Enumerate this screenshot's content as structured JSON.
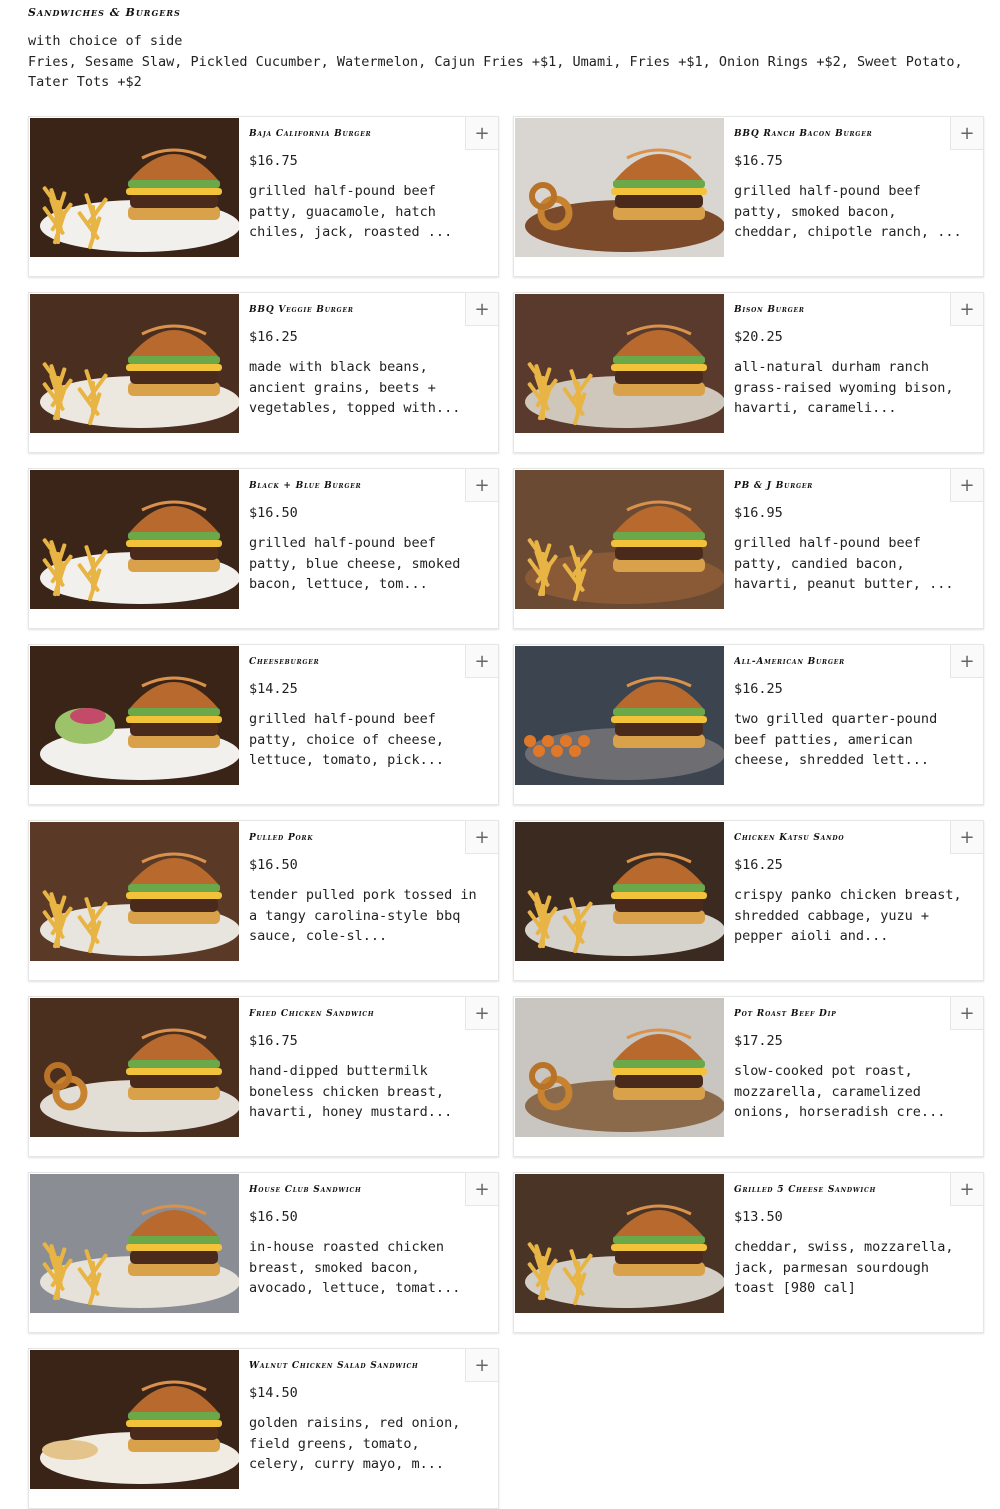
{
  "section": {
    "title": "Sandwiches & Burgers",
    "subtitle": "with choice of side",
    "sides": "Fries, Sesame Slaw, Pickled Cucumber, Watermelon, Cajun Fries +$1, Umami, Fries +$1, Onion Rings +$2, Sweet Potato, Tater Tots +$2"
  },
  "add_label": "+",
  "items": [
    {
      "name": "Baja California Burger",
      "price": "$16.75",
      "desc": "grilled half-pound beef patty, guacamole, hatch chiles, jack, roasted ...",
      "bg": "#3a2418",
      "plate": "#f2f0ec",
      "side": "fries"
    },
    {
      "name": "BBQ Ranch Bacon Burger",
      "price": "$16.75",
      "desc": "grilled half-pound beef patty, smoked bacon, cheddar, chipotle ranch, ...",
      "bg": "#d9d6d2",
      "plate": "#7a4a2a",
      "side": "rings"
    },
    {
      "name": "BBQ Veggie Burger",
      "price": "$16.25",
      "desc": "made with black beans, ancient grains, beets + vegetables, topped with...",
      "bg": "#4a2e20",
      "plate": "#ece7df",
      "side": "fries"
    },
    {
      "name": "Bison Burger",
      "price": "$20.25",
      "desc": "all-natural durham ranch grass-raised wyoming bison, havarti, carameli...",
      "bg": "#5a3a2c",
      "plate": "#cfc6bc",
      "side": "fries"
    },
    {
      "name": "Black + Blue Burger",
      "price": "$16.50",
      "desc": "grilled half-pound beef patty, blue cheese, smoked bacon, lettuce, tom...",
      "bg": "#3b2519",
      "plate": "#f2f0ec",
      "side": "fries"
    },
    {
      "name": "PB & J Burger",
      "price": "$16.95",
      "desc": "grilled half-pound beef patty, candied bacon, havarti, peanut butter, ...",
      "bg": "#6b4a33",
      "plate": "#8a5a36",
      "side": "fries"
    },
    {
      "name": "Cheeseburger",
      "price": "$14.25",
      "desc": "grilled half-pound beef patty, choice of cheese, lettuce, tomato, pick...",
      "bg": "#3a2418",
      "plate": "#f2f0ec",
      "side": "salad"
    },
    {
      "name": "All-American Burger",
      "price": "$16.25",
      "desc": "two grilled quarter-pound beef patties, american cheese, shredded lett...",
      "bg": "#3c4450",
      "plate": "#6e6e72",
      "side": "tots"
    },
    {
      "name": "Pulled Pork",
      "price": "$16.50",
      "desc": "tender pulled pork tossed in a tangy carolina-style bbq sauce, cole-sl...",
      "bg": "#5a3a26",
      "plate": "#e8e4de",
      "side": "fries"
    },
    {
      "name": "Chicken Katsu Sando",
      "price": "$16.25",
      "desc": "crispy panko chicken breast, shredded cabbage, yuzu + pepper aioli and...",
      "bg": "#3a2a20",
      "plate": "#d6d2cc",
      "side": "fries"
    },
    {
      "name": "Fried Chicken Sandwich",
      "price": "$16.75",
      "desc": "hand-dipped buttermilk boneless chicken breast, havarti, honey mustard...",
      "bg": "#4a2e1e",
      "plate": "#e2ddd5",
      "side": "rings"
    },
    {
      "name": "Pot Roast Beef Dip",
      "price": "$17.25",
      "desc": "slow-cooked pot roast, mozzarella, caramelized onions, horseradish cre...",
      "bg": "#c9c6c2",
      "plate": "#8a6a4a",
      "side": "rings"
    },
    {
      "name": "House Club Sandwich",
      "price": "$16.50",
      "desc": "in-house roasted chicken breast, smoked bacon, avocado, lettuce, tomat...",
      "bg": "#8a8e94",
      "plate": "#e6e2da",
      "side": "fries"
    },
    {
      "name": "Grilled 5 Cheese Sandwich",
      "price": "$13.50",
      "desc": "cheddar, swiss, mozzarella, jack, parmesan sourdough toast [980 cal]",
      "bg": "#4a3426",
      "plate": "#d4cfc6",
      "side": "fries"
    },
    {
      "name": "Walnut Chicken Salad Sandwich",
      "price": "$14.50",
      "desc": "golden raisins, red onion, field greens, tomato, celery, curry mayo, m...",
      "bg": "#3a2418",
      "plate": "#f0ece4",
      "side": "chips"
    }
  ]
}
